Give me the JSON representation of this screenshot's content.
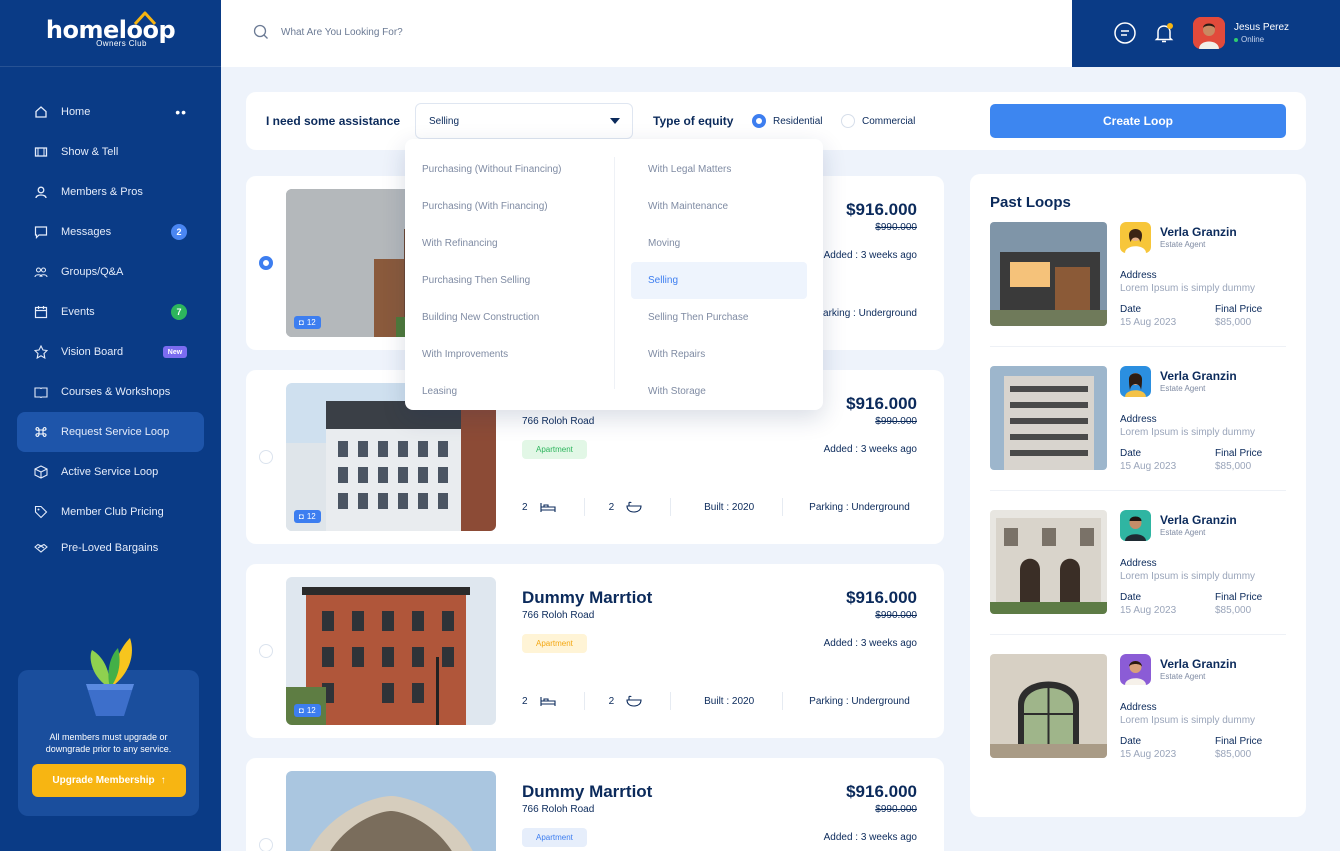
{
  "brand": {
    "word": "homeloop",
    "sub": "Owners Club"
  },
  "search": {
    "placeholder": "What Are You Looking For?"
  },
  "user": {
    "name": "Jesus Perez",
    "status": "Online"
  },
  "sidebar": {
    "items": [
      {
        "label": "Home",
        "icon": "home-icon"
      },
      {
        "label": "Show & Tell",
        "icon": "film-icon"
      },
      {
        "label": "Members & Pros",
        "icon": "user-icon"
      },
      {
        "label": "Messages",
        "icon": "chat-icon",
        "badge": "2"
      },
      {
        "label": "Groups/Q&A",
        "icon": "group-icon"
      },
      {
        "label": "Events",
        "icon": "calendar-icon",
        "badge": "7"
      },
      {
        "label": "Vision Board",
        "icon": "pin-icon",
        "badge": "New"
      },
      {
        "label": "Courses & Workshops",
        "icon": "book-icon"
      },
      {
        "label": "Request Service Loop",
        "icon": "command-icon"
      },
      {
        "label": "Active Service Loop",
        "icon": "box-icon"
      },
      {
        "label": "Member Club Pricing",
        "icon": "tag-icon"
      },
      {
        "label": "Pre-Loved Bargains",
        "icon": "handshake-icon"
      }
    ],
    "promo_text": "All members must upgrade or downgrade prior to any service.",
    "upgrade_label": "Upgrade Membership"
  },
  "filter": {
    "assist_label": "I need some assistance",
    "selected": "Selling",
    "equity_label": "Type of equity",
    "equity_options": [
      "Residential",
      "Commercial"
    ],
    "equity_selected": "Residential",
    "create_label": "Create Loop"
  },
  "dropdown": {
    "left": [
      "Purchasing (Without Financing)",
      "Purchasing (With Financing)",
      "With Refinancing",
      "Purchasing Then Selling",
      "Building New Construction",
      "With Improvements",
      "Leasing"
    ],
    "right": [
      "With Legal Matters",
      "With Maintenance",
      "Moving",
      "Selling",
      "Selling Then Purchase",
      "With Repairs",
      "With Storage"
    ],
    "active": "Selling"
  },
  "listings": [
    {
      "photo_count": "12",
      "price": "$916.000",
      "old_price": "$990.000",
      "added": "Added : 3 weeks ago",
      "parking": "Parking : Underground",
      "selected": true
    },
    {
      "photo_count": "12",
      "address": "766 Roloh Road",
      "tag": "Apartment",
      "price": "$916.000",
      "old_price": "$990.000",
      "added": "Added : 3 weeks ago",
      "beds": "2",
      "baths": "2",
      "built": "Built : 2020",
      "parking": "Parking : Underground"
    },
    {
      "photo_count": "12",
      "title": "Dummy Marrtiot",
      "address": "766 Roloh Road",
      "tag": "Apartment",
      "price": "$916.000",
      "old_price": "$990.000",
      "added": "Added : 3 weeks ago",
      "beds": "2",
      "baths": "2",
      "built": "Built : 2020",
      "parking": "Parking : Underground"
    },
    {
      "title": "Dummy Marrtiot",
      "address": "766 Roloh Road",
      "tag": "Apartment",
      "price": "$916.000",
      "old_price": "$990.000",
      "added": "Added : 3 weeks ago"
    }
  ],
  "past_loops": {
    "title": "Past Loops",
    "items": [
      {
        "name": "Verla Granzin",
        "role": "Estate Agent",
        "address_label": "Address",
        "address": "Lorem Ipsum is simply dummy",
        "date_label": "Date",
        "date": "15 Aug 2023",
        "price_label": "Final Price",
        "price": "$85,000"
      },
      {
        "name": "Verla Granzin",
        "role": "Estate Agent",
        "address_label": "Address",
        "address": "Lorem Ipsum is simply dummy",
        "date_label": "Date",
        "date": "15 Aug 2023",
        "price_label": "Final Price",
        "price": "$85,000"
      },
      {
        "name": "Verla Granzin",
        "role": "Estate Agent",
        "address_label": "Address",
        "address": "Lorem Ipsum is simply dummy",
        "date_label": "Date",
        "date": "15 Aug 2023",
        "price_label": "Final Price",
        "price": "$85,000"
      },
      {
        "name": "Verla Granzin",
        "role": "Estate Agent",
        "address_label": "Address",
        "address": "Lorem Ipsum is simply dummy",
        "date_label": "Date",
        "date": "15 Aug 2023",
        "price_label": "Final Price",
        "price": "$85,000"
      }
    ]
  },
  "colors": {
    "navy": "#0a3b86",
    "accent": "#3d86f0",
    "yellow": "#f7b512",
    "green": "#2db55d"
  }
}
